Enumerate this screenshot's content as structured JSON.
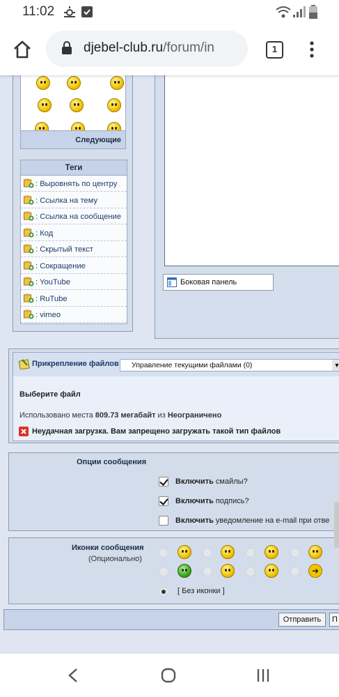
{
  "status": {
    "time": "11:02"
  },
  "browser": {
    "url_domain": "djebel-club.ru",
    "url_path": "/forum/in",
    "tab_count": "1"
  },
  "smilies": {
    "next_label": "Следующие"
  },
  "tags": {
    "title": "Теги",
    "items": [
      ": Выровнять по центру",
      ": Ссылка на тему",
      ": Ссылка на сообщение",
      ": Код",
      ": Скрытый текст",
      ": Сокращение",
      ": YouTube",
      ": RuTube",
      ": vimeo"
    ]
  },
  "editor": {
    "sidebar_button": "Боковая панель"
  },
  "attachments": {
    "label": "Прикрепление файлов",
    "manage_select": "Управление текущими файлами (0)",
    "choose_file": "Выберите файл",
    "usage_prefix": "Использовано места ",
    "usage_value": "809.73 мегабайт",
    "usage_mid": " из ",
    "usage_limit": "Неограничено",
    "error": "Неудачная загрузка. Вам запрещено загружать такой тип файлов"
  },
  "options": {
    "title": "Опции сообщения",
    "items": [
      {
        "bold": "Включить",
        "rest": " смайлы?",
        "checked": true
      },
      {
        "bold": "Включить",
        "rest": " подпись?",
        "checked": true
      },
      {
        "bold": "Включить",
        "rest": " уведомление на e-mail при отве",
        "checked": false
      }
    ]
  },
  "icons": {
    "title": "Иконки сообщения",
    "subtitle": "(Опционально)",
    "none_label": "[ Без иконки ]"
  },
  "actions": {
    "submit": "Отправить",
    "second": "П"
  },
  "colors": {
    "accent": "#1d3a6b",
    "page_bg": "#dfe6f1",
    "error_icon": "#d9322b"
  }
}
